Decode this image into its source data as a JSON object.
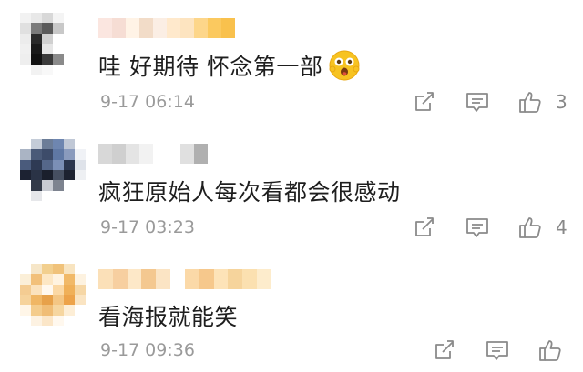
{
  "comments": [
    {
      "text": "哇 好期待 怀念第一部",
      "date": "9-17 06:14",
      "like_count": "3",
      "has_emoji": true
    },
    {
      "text": "疯狂原始人每次看都会很感动",
      "date": "9-17 03:23",
      "like_count": "4",
      "has_emoji": false
    },
    {
      "text": "看海报就能笑",
      "date": "9-17 09:36",
      "like_count": "",
      "has_emoji": false
    }
  ],
  "icons": {
    "share": "share-icon",
    "reply": "comment-icon",
    "like": "thumbs-up-icon",
    "emoji": "excited-face-emoji"
  },
  "colors": {
    "text": "#1e1e1e",
    "meta": "#9a9a9a",
    "icon": "#8a8a8a",
    "emoji_face": "#f7c321"
  }
}
